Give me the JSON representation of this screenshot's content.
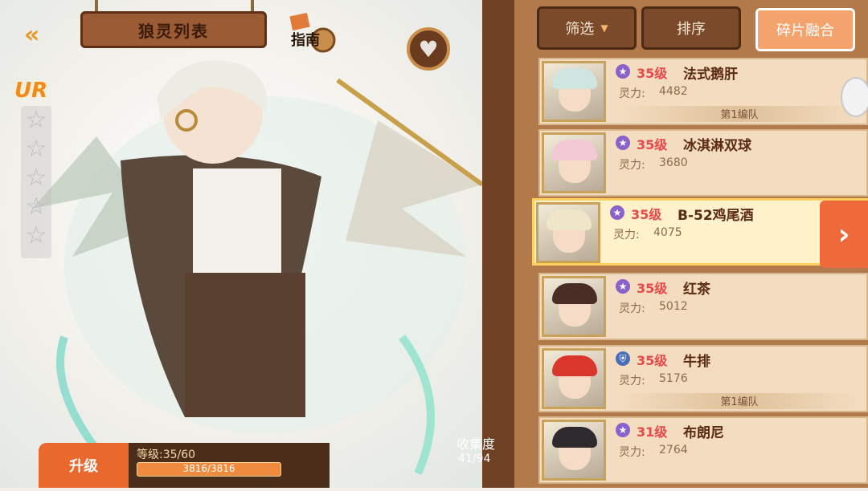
{
  "header": {
    "title": "狼灵列表",
    "guide_label": "指南"
  },
  "hero": {
    "rarity": "UR",
    "stars_total": 5,
    "stars_filled": 0
  },
  "collection": {
    "label": "收集度",
    "value": "41/94"
  },
  "upgrade": {
    "button_label": "升级",
    "level_text": "等级:35/60",
    "exp_text": "3816/3816",
    "exp_fraction": 1.0
  },
  "toolbar": {
    "filter_label": "筛选",
    "sort_label": "排序",
    "fuse_label": "碎片融合"
  },
  "list": {
    "power_label": "灵力:",
    "items": [
      {
        "level": "35级",
        "name": "法式鹅肝",
        "power": "4482",
        "team": "第1编队",
        "rank_icon": "star-badge-icon",
        "hair": "#cfe6e0"
      },
      {
        "level": "35级",
        "name": "冰淇淋双球",
        "power": "3680",
        "team": "",
        "rank_icon": "star-badge-icon",
        "hair": "#f3c9d6"
      },
      {
        "level": "35级",
        "name": "B-52鸡尾酒",
        "power": "4075",
        "team": "",
        "rank_icon": "star-badge-icon",
        "hair": "#efe6c8",
        "selected": true
      },
      {
        "level": "35级",
        "name": "红茶",
        "power": "5012",
        "team": "",
        "rank_icon": "star-badge-icon",
        "hair": "#4a2e26"
      },
      {
        "level": "35级",
        "name": "牛排",
        "power": "5176",
        "team": "第1编队",
        "rank_icon": "shield-badge-icon",
        "hair": "#d9362c"
      },
      {
        "level": "31级",
        "name": "布朗尼",
        "power": "2764",
        "team": "",
        "rank_icon": "star-badge-icon",
        "hair": "#2f2a2e"
      }
    ]
  },
  "colors": {
    "accent_orange": "#ef6a3a",
    "level_red": "#e8484a",
    "wood_dark": "#6e4125"
  }
}
